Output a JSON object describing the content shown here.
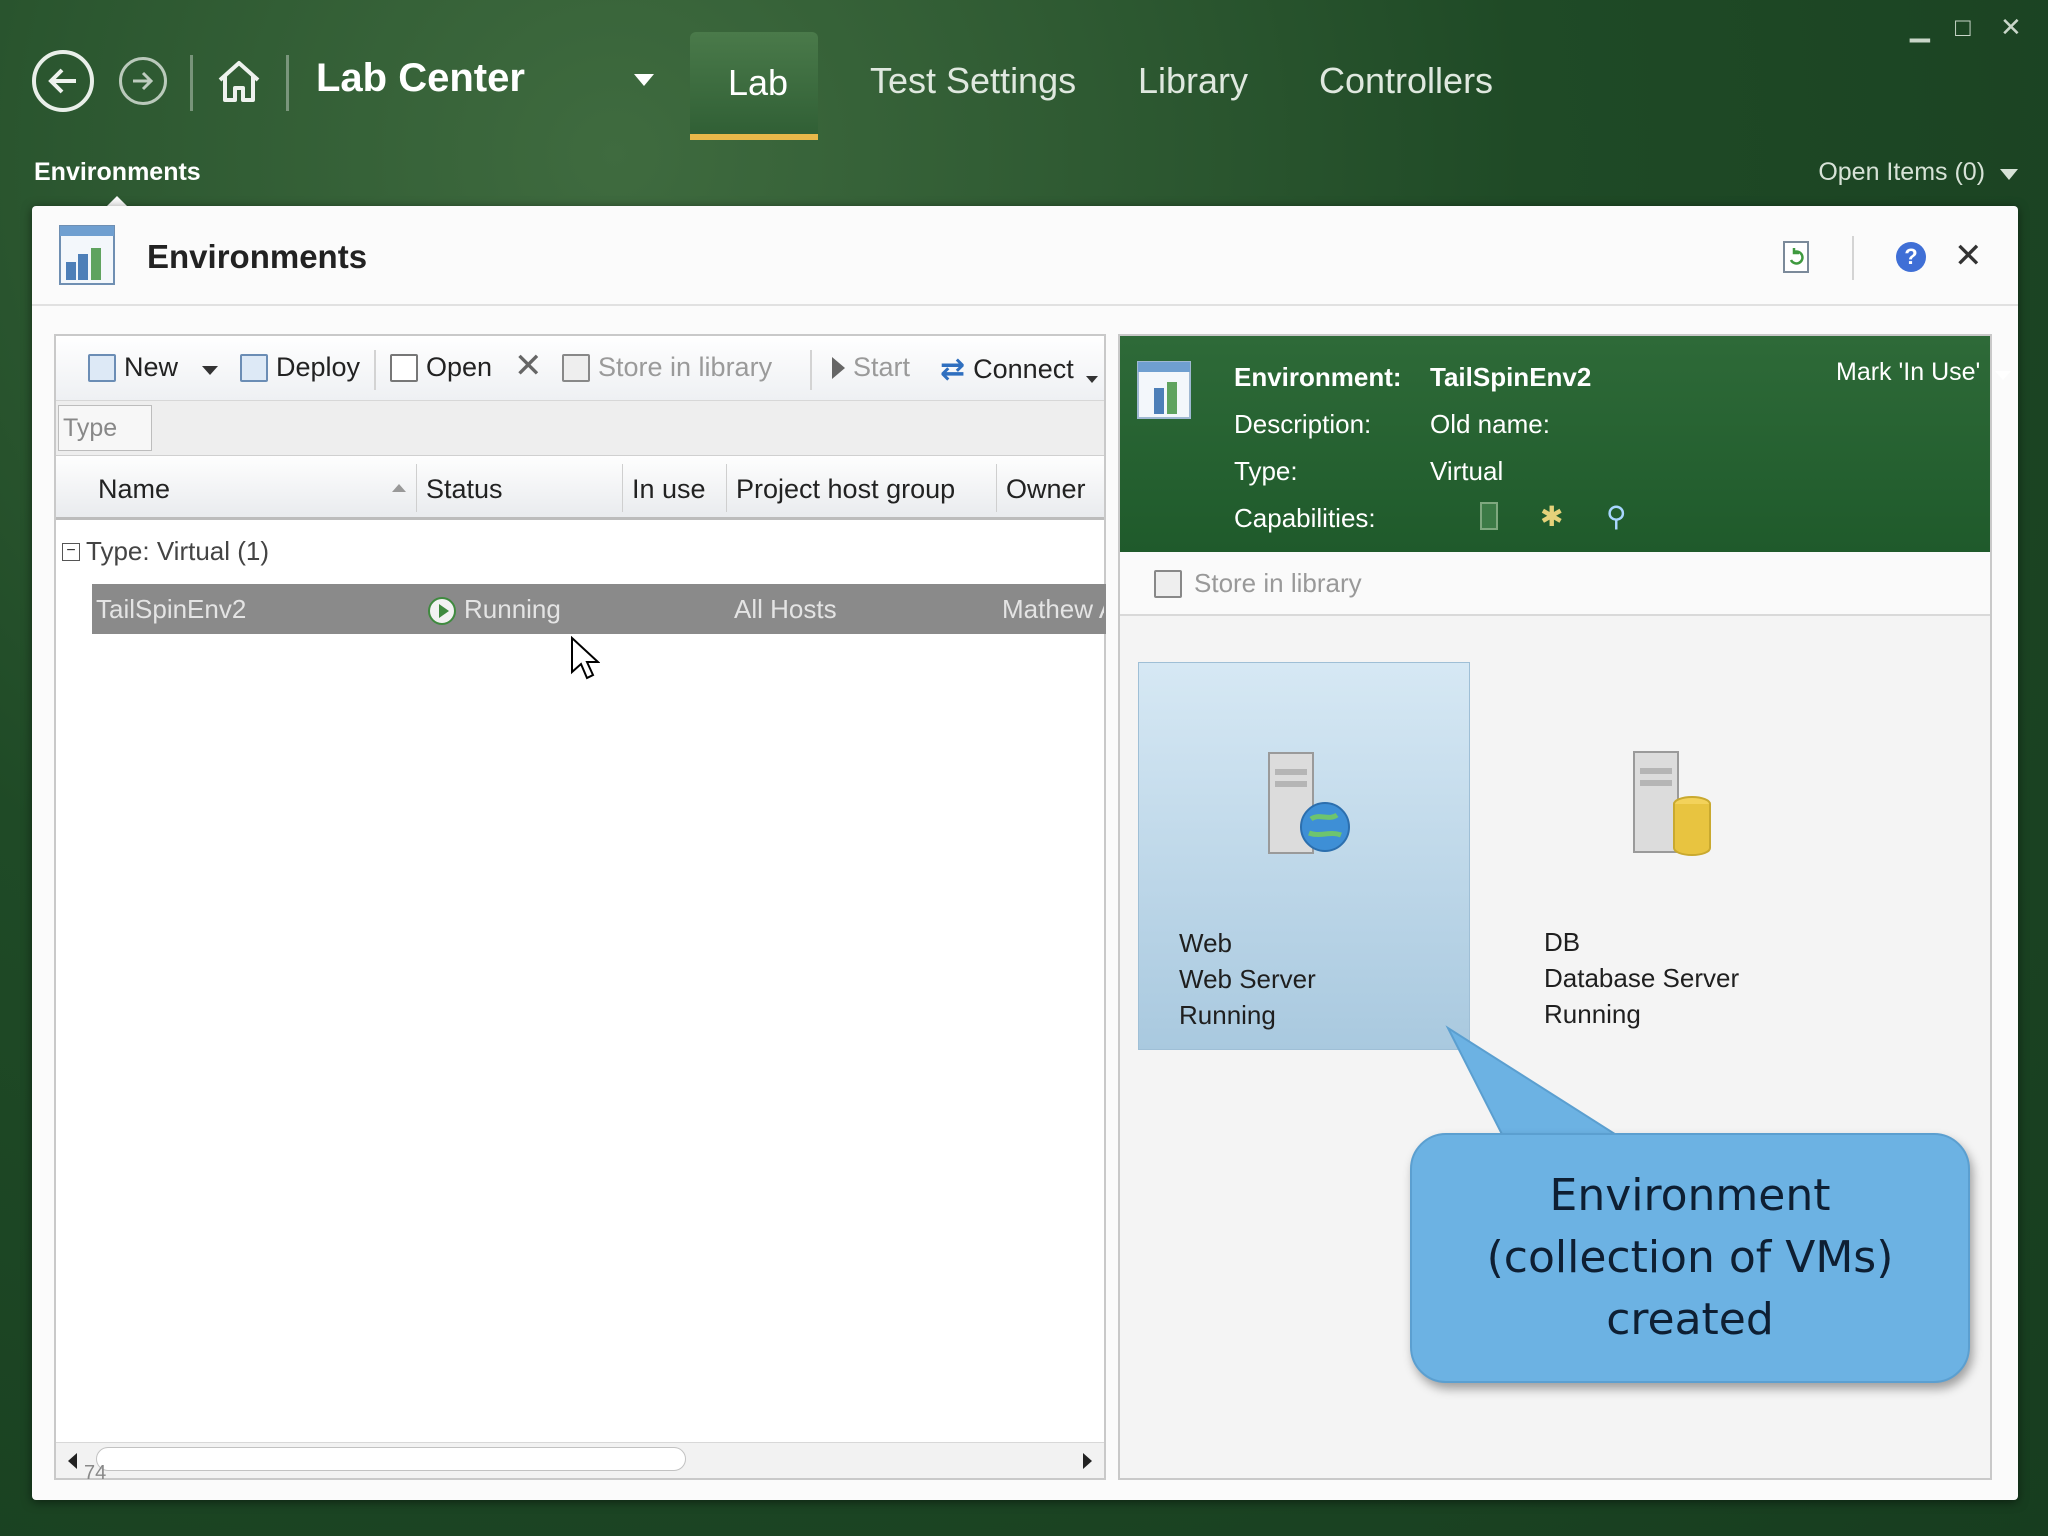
{
  "window": {
    "minimize": "▁",
    "maximize": "□",
    "close": "✕"
  },
  "nav": {
    "back_icon": "back-arrow-icon",
    "forward_icon": "forward-arrow-icon",
    "home_icon": "home-icon",
    "app_title": "Lab Center",
    "tabs": [
      {
        "label": "Lab",
        "active": true
      },
      {
        "label": "Test Settings"
      },
      {
        "label": "Library"
      },
      {
        "label": "Controllers"
      }
    ]
  },
  "breadcrumb": "Environments",
  "open_items": "Open Items (0)",
  "panel": {
    "title": "Environments",
    "toolbar": {
      "new": "New",
      "deploy": "Deploy",
      "open": "Open",
      "store": "Store in library",
      "start": "Start",
      "connect": "Connect"
    },
    "group_chip": "Type",
    "columns": [
      "Name",
      "Status",
      "In use",
      "Project host group",
      "Owner"
    ],
    "group_row": "Type: Virtual (1)",
    "rows": [
      {
        "name": "TailSpinEnv2",
        "status": "Running",
        "in_use": "",
        "host_group": "All Hosts",
        "owner": "Mathew A"
      }
    ],
    "page_number": "74"
  },
  "details": {
    "labels": {
      "environment": "Environment:",
      "description": "Description:",
      "type": "Type:",
      "capabilities": "Capabilities:"
    },
    "values": {
      "environment": "TailSpinEnv2",
      "description": "Old name:",
      "type": "Virtual"
    },
    "mark_in_use": "Mark 'In Use'",
    "store_in_library": "Store in library",
    "machines": [
      {
        "name": "Web",
        "role": "Web Server",
        "status": "Running",
        "selected": true
      },
      {
        "name": "DB",
        "role": "Database Server",
        "status": "Running",
        "selected": false
      }
    ]
  },
  "callout": "Environment (collection of VMs) created",
  "colors": {
    "accent_green": "#1f5a2b",
    "tab_underline": "#e8b84a",
    "callout_blue": "#6cb2e3"
  }
}
